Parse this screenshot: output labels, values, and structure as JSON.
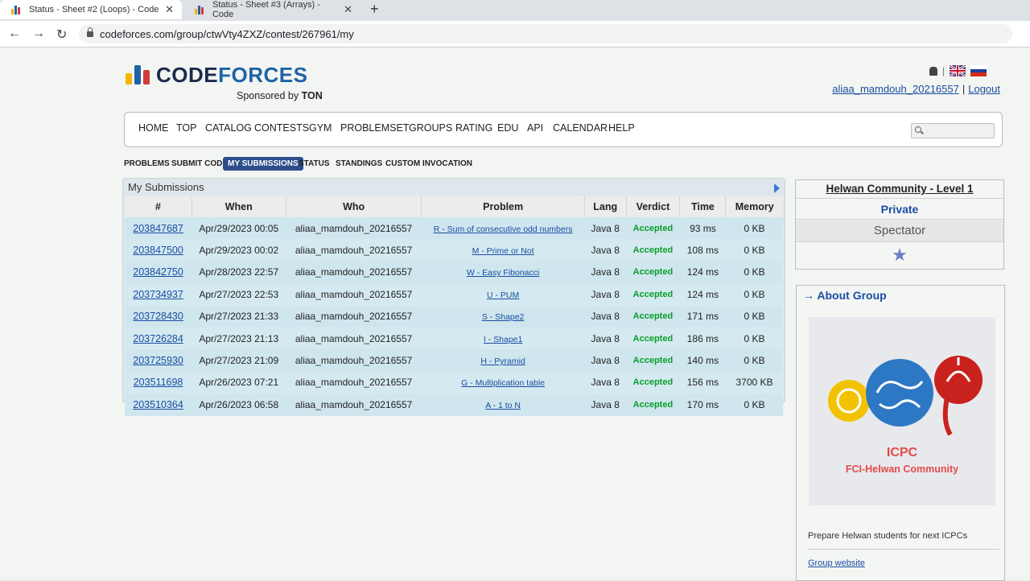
{
  "browser": {
    "tabs": [
      {
        "title": "Status - Sheet #2 (Loops) - Code",
        "active": true
      },
      {
        "title": "Status - Sheet #3 (Arrays) - Code",
        "active": false
      }
    ],
    "new_tab": "+",
    "url": "codeforces.com/group/ctwVty4ZXZ/contest/267961/my"
  },
  "header": {
    "logo_part1": "CODE",
    "logo_part2": "FORCES",
    "sponsor_prefix": "Sponsored by",
    "sponsor_name": "TON",
    "username": "aliaa_mamdouh_20216557",
    "separator": "|",
    "logout": "Logout"
  },
  "menu": [
    "HOME",
    "TOP",
    "CATALOG",
    "CONTESTS",
    "GYM",
    "PROBLEMSET",
    "GROUPS",
    "RATING",
    "EDU",
    "API",
    "CALENDAR",
    "HELP"
  ],
  "subnav": [
    "PROBLEMS",
    "SUBMIT CODE",
    "MY SUBMISSIONS",
    "STATUS",
    "STANDINGS",
    "CUSTOM INVOCATION"
  ],
  "submissions": {
    "title": "My Submissions",
    "columns": [
      "#",
      "When",
      "Who",
      "Problem",
      "Lang",
      "Verdict",
      "Time",
      "Memory"
    ],
    "rows": [
      {
        "id": "203847687",
        "when": "Apr/29/2023 00:05",
        "who": "aliaa_mamdouh_20216557",
        "problem": "R - Sum of consecutive odd numbers",
        "lang": "Java 8",
        "verdict": "Accepted",
        "time": "93 ms",
        "memory": "0 KB"
      },
      {
        "id": "203847500",
        "when": "Apr/29/2023 00:02",
        "who": "aliaa_mamdouh_20216557",
        "problem": "M - Prime or Not",
        "lang": "Java 8",
        "verdict": "Accepted",
        "time": "108 ms",
        "memory": "0 KB"
      },
      {
        "id": "203842750",
        "when": "Apr/28/2023 22:57",
        "who": "aliaa_mamdouh_20216557",
        "problem": "W - Easy Fibonacci",
        "lang": "Java 8",
        "verdict": "Accepted",
        "time": "124 ms",
        "memory": "0 KB"
      },
      {
        "id": "203734937",
        "when": "Apr/27/2023 22:53",
        "who": "aliaa_mamdouh_20216557",
        "problem": "U - PUM",
        "lang": "Java 8",
        "verdict": "Accepted",
        "time": "124 ms",
        "memory": "0 KB"
      },
      {
        "id": "203728430",
        "when": "Apr/27/2023 21:33",
        "who": "aliaa_mamdouh_20216557",
        "problem": "S - Shape2",
        "lang": "Java 8",
        "verdict": "Accepted",
        "time": "171 ms",
        "memory": "0 KB"
      },
      {
        "id": "203726284",
        "when": "Apr/27/2023 21:13",
        "who": "aliaa_mamdouh_20216557",
        "problem": "I - Shape1",
        "lang": "Java 8",
        "verdict": "Accepted",
        "time": "186 ms",
        "memory": "0 KB"
      },
      {
        "id": "203725930",
        "when": "Apr/27/2023 21:09",
        "who": "aliaa_mamdouh_20216557",
        "problem": "H - Pyramid",
        "lang": "Java 8",
        "verdict": "Accepted",
        "time": "140 ms",
        "memory": "0 KB"
      },
      {
        "id": "203511698",
        "when": "Apr/26/2023 07:21",
        "who": "aliaa_mamdouh_20216557",
        "problem": "G - Multiplication table",
        "lang": "Java 8",
        "verdict": "Accepted",
        "time": "156 ms",
        "memory": "3700 KB"
      },
      {
        "id": "203510364",
        "when": "Apr/26/2023 06:58",
        "who": "aliaa_mamdouh_20216557",
        "problem": "A - 1 to N",
        "lang": "Java 8",
        "verdict": "Accepted",
        "time": "170 ms",
        "memory": "0 KB"
      }
    ]
  },
  "contest": {
    "title": "Helwan Community - Level 1",
    "visibility": "Private",
    "role": "Spectator",
    "star_icon": "star-icon"
  },
  "group": {
    "heading": "→ About Group",
    "caption1": "ICPC",
    "caption2": "FCI-Helwan Community",
    "description": "Prepare Helwan students for next ICPCs",
    "website": "Group website"
  },
  "colors": {
    "accent": "#1a4da3",
    "accepted": "#0a9e2b",
    "brand_dark": "#1d2a4d",
    "brand_blue": "#1f62a8"
  }
}
